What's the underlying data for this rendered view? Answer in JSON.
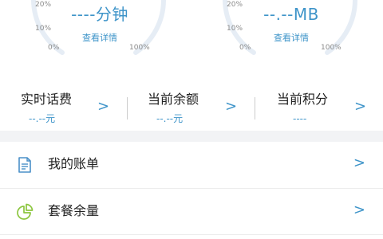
{
  "gauges": [
    {
      "value": "----分钟",
      "link": "查看详情",
      "tick_labels": [
        "20%",
        "10%",
        "0%",
        "100%"
      ]
    },
    {
      "value": "--.--MB",
      "link": "查看详情",
      "tick_labels": [
        "20%",
        "10%",
        "0%",
        "100%"
      ]
    }
  ],
  "stats": [
    {
      "label": "实时话费",
      "value": "--.--元"
    },
    {
      "label": "当前余额",
      "value": "--.--元"
    },
    {
      "label": "当前积分",
      "value": "----"
    }
  ],
  "menu": [
    {
      "label": "我的账单",
      "icon": "bill-document-icon"
    },
    {
      "label": "套餐余量",
      "icon": "pie-chart-icon"
    }
  ],
  "chevron": ">",
  "colors": {
    "accent": "#3e94c9",
    "gauge_track": "#e6edf5",
    "icon_blue": "#4a90c8",
    "icon_green": "#8cc63f"
  }
}
